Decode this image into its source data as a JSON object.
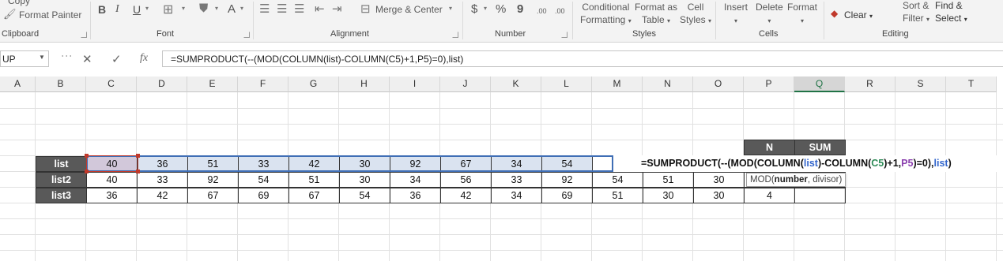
{
  "ribbon": {
    "clipboard": {
      "copy": "Copy",
      "format_painter": "Format Painter",
      "group": "Clipboard"
    },
    "font": {
      "bold": "B",
      "italic": "I",
      "underline": "U",
      "font_color": "A",
      "group": "Font"
    },
    "alignment": {
      "merge_center": "Merge & Center",
      "group": "Alignment"
    },
    "number": {
      "currency": "$",
      "percent": "%",
      "comma": "9",
      "inc_decimal": ".00",
      "dec_decimal": ".00",
      "group": "Number"
    },
    "styles": {
      "conditional_line1": "Conditional",
      "conditional_line2": "Formatting",
      "table_line1": "Format as",
      "table_line2": "Table",
      "cell_line1": "Cell",
      "cell_line2": "Styles",
      "group": "Styles"
    },
    "cells": {
      "insert": "Insert",
      "delete": "Delete",
      "format": "Format",
      "group": "Cells"
    },
    "editing": {
      "clear": "Clear",
      "sort_line1": "Sort &",
      "sort_line2": "Filter",
      "find_line1": "Find &",
      "find_line2": "Select",
      "group": "Editing"
    }
  },
  "formula_bar": {
    "name_box": "UP",
    "cancel": "✕",
    "enter": "✓",
    "fx": "fx",
    "formula": "=SUMPRODUCT(--(MOD(COLUMN(list)-COLUMN(C5)+1,P5)=0),list)"
  },
  "columns": [
    "A",
    "B",
    "C",
    "D",
    "E",
    "F",
    "G",
    "H",
    "I",
    "J",
    "K",
    "L",
    "M",
    "N",
    "O",
    "P",
    "Q",
    "R",
    "S",
    "T"
  ],
  "selected_column": "Q",
  "headers": {
    "n": "N",
    "sum": "SUM"
  },
  "rows": [
    {
      "label": "list",
      "values": [
        "40",
        "36",
        "51",
        "33",
        "42",
        "30",
        "92",
        "67",
        "34",
        "54"
      ]
    },
    {
      "label": "list2",
      "values": [
        "40",
        "33",
        "92",
        "54",
        "51",
        "30",
        "34",
        "56",
        "33",
        "92",
        "54",
        "51",
        "30"
      ]
    },
    {
      "label": "list3",
      "values": [
        "36",
        "42",
        "67",
        "69",
        "67",
        "54",
        "36",
        "42",
        "34",
        "69",
        "51",
        "30",
        "30"
      ],
      "n": "4"
    }
  ],
  "edit_formula": {
    "p1": "=SUMPRODUCT(--(MOD(COLUMN(",
    "ref_list": "list",
    "p2": ")-COLUMN(",
    "ref_c5": "C5",
    "p3": ")+1,",
    "ref_p5": "P5",
    "p4": ")=0),",
    "ref_list2": "list",
    "p5": ")"
  },
  "tooltip": {
    "fn": "MOD(",
    "arg1": "number",
    "rest": ", divisor)"
  }
}
